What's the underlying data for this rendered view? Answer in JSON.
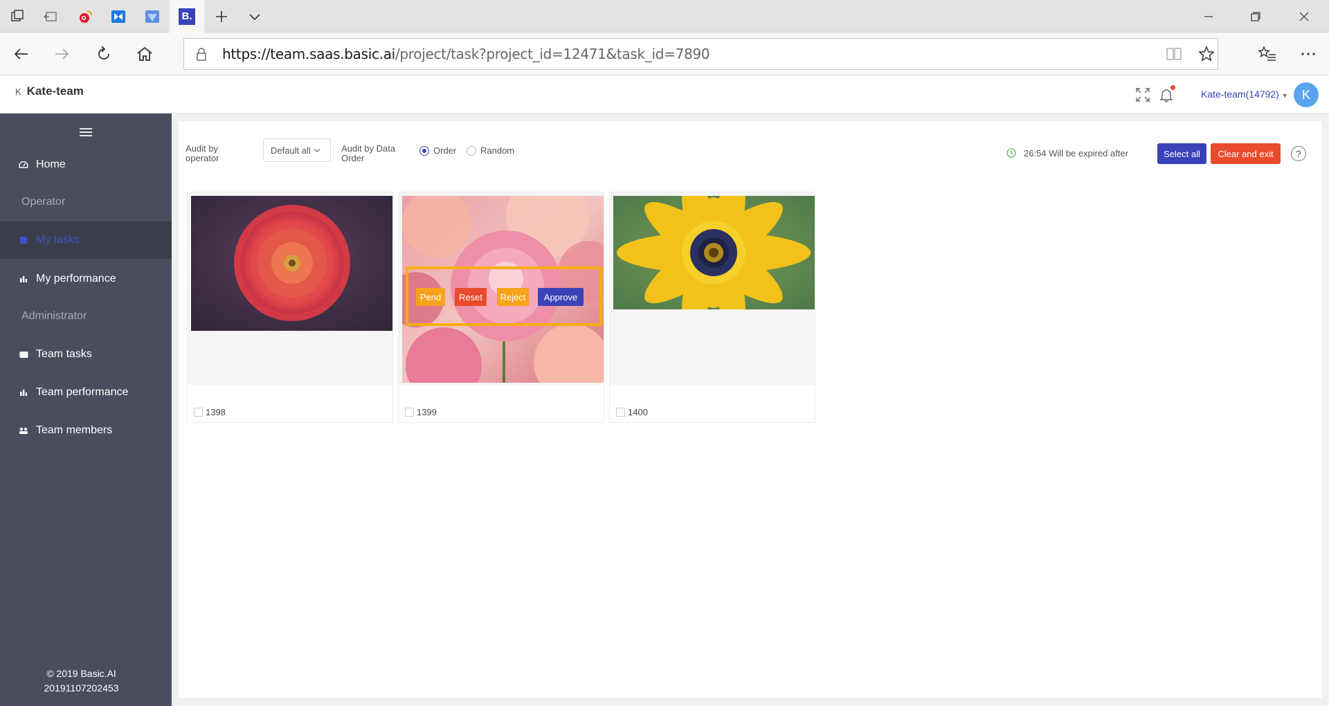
{
  "browser": {
    "url_host": "https://team.saas.basic.ai",
    "url_path": "/project/task?project_id=12471&task_id=7890",
    "tabs": [
      {
        "icon": "tab-actions-icon"
      },
      {
        "icon": "set-aside-tabs-icon"
      },
      {
        "icon": "weibo-tab-icon"
      },
      {
        "icon": "app-tab-icon"
      },
      {
        "icon": "app-tab-icon"
      },
      {
        "icon": "basic-ai-tab-icon",
        "label": "B.",
        "active": true
      }
    ]
  },
  "header": {
    "brand_mark": "K",
    "brand": "Kate-team",
    "team_account": "Kate-team(14792)",
    "avatar_letter": "K"
  },
  "sidebar": {
    "home": "Home",
    "group_operator": "Operator",
    "my_tasks": "My tasks",
    "my_performance": "My performance",
    "group_admin": "Administrator",
    "team_tasks": "Team tasks",
    "team_performance": "Team performance",
    "team_members": "Team members",
    "copyright": "© 2019 Basic.AI",
    "build": "20191107202453"
  },
  "toolbar": {
    "audit_operator_l1": "Audit by",
    "audit_operator_l2": "operator",
    "operator_select": "Default all",
    "audit_data_l1": "Audit by Data",
    "audit_data_l2": "Order",
    "radio_order": "Order",
    "radio_random": "Random",
    "selected_mode": "Order",
    "timer": "26:54 Will be expired after",
    "select_all": "Select all",
    "clear_exit": "Clear and exit",
    "help": "?"
  },
  "cards": [
    {
      "id": "1398",
      "subject": "red zinnia flower"
    },
    {
      "id": "1399",
      "subject": "pink dahlia flowers"
    },
    {
      "id": "1400",
      "subject": "yellow daisy flower"
    }
  ],
  "overlay_actions": {
    "pend": "Pend",
    "reset": "Reset",
    "reject": "Reject",
    "approve": "Approve"
  },
  "colors": {
    "primary": "#3a42b9",
    "danger": "#e94b2c",
    "warning": "#f7a31c",
    "sidebar": "#4a4e5c",
    "highlight": "#f7ad15"
  }
}
